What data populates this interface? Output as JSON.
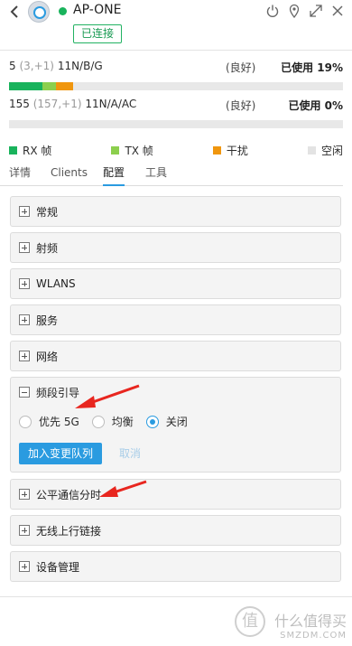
{
  "header": {
    "device_name": "AP-ONE",
    "state": "已连接"
  },
  "radios": [
    {
      "channel": "5",
      "extra": "(3,+1)",
      "mode": "11N/B/G",
      "quality": "(良好)",
      "used": "已使用 19%",
      "rx": 0.1,
      "tx": 0.04,
      "interference": 0.05
    },
    {
      "channel": "155",
      "extra": "(157,+1)",
      "mode": "11N/A/AC",
      "quality": "(良好)",
      "used": "已使用 0%",
      "rx": 0,
      "tx": 0,
      "interference": 0
    }
  ],
  "legend": [
    {
      "label": "RX 帧",
      "color": "#19b35c"
    },
    {
      "label": "TX 帧",
      "color": "#8ccf4d"
    },
    {
      "label": "干扰",
      "color": "#f0960e"
    },
    {
      "label": "空闲",
      "color": "#e3e3e3"
    }
  ],
  "tabs": [
    "详情",
    "Clients",
    "配置",
    "工具"
  ],
  "active_tab": "配置",
  "panels": {
    "general": "常规",
    "radio": "射频",
    "wlans": "WLANS",
    "services": "服务",
    "network": "网络",
    "band_steering": "频段引导",
    "airtime_fairness": "公平通信分时",
    "wireless_uplink": "无线上行链接",
    "device_management": "设备管理"
  },
  "band_steering": {
    "options": [
      "优先 5G",
      "均衡",
      "关闭"
    ],
    "selected": "关闭",
    "queue_button": "加入变更队列",
    "cancel_button": "取消"
  },
  "watermark": {
    "logo_char": "值",
    "text": "什么值得买",
    "sub": "SMZDM.COM"
  }
}
